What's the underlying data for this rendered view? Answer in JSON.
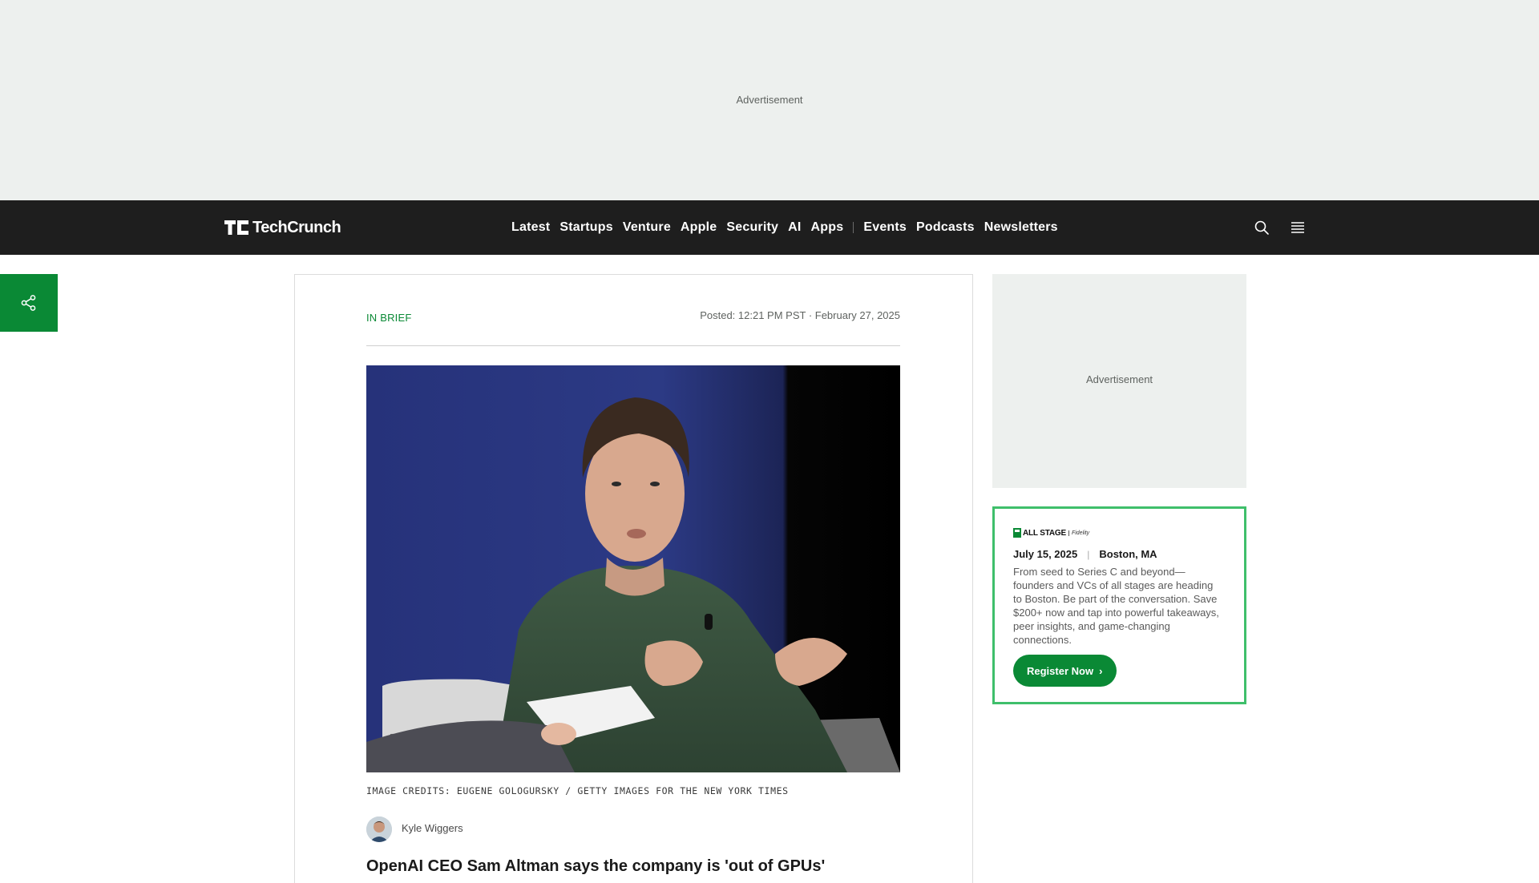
{
  "top_ad": {
    "label": "Advertisement"
  },
  "header": {
    "logo_text": "TechCrunch",
    "nav": {
      "primary": [
        "Latest",
        "Startups",
        "Venture",
        "Apple",
        "Security",
        "AI",
        "Apps"
      ],
      "secondary": [
        "Events",
        "Podcasts",
        "Newsletters"
      ]
    },
    "icons": {
      "search": "search-icon",
      "menu": "hamburger-menu-icon"
    }
  },
  "share": {
    "icon": "share-icon"
  },
  "article": {
    "kicker": "IN BRIEF",
    "posted": "Posted: 12:21 PM PST · February 27, 2025",
    "image_credits": "IMAGE CREDITS: EUGENE GOLOGURSKY / GETTY IMAGES FOR THE NEW YORK TIMES",
    "author": "Kyle Wiggers",
    "headline": "OpenAI CEO Sam Altman says the company is 'out of GPUs'"
  },
  "sidebar": {
    "ad_label": "Advertisement",
    "promo": {
      "logo_text": "ALL STAGE",
      "logo_sub": "Fidelity",
      "date": "July 15, 2025",
      "location": "Boston, MA",
      "description": "From seed to Series C and beyond—founders and VCs of all stages are heading to Boston. Be part of the conversation. Save $200+ now and tap into powerful takeaways, peer insights, and game-changing connections.",
      "cta": "Register Now",
      "accent": "#0a8935"
    }
  },
  "colors": {
    "brand_green": "#0a8935",
    "nav_bg": "#1e1e1e",
    "ad_bg": "#edf0ee"
  }
}
